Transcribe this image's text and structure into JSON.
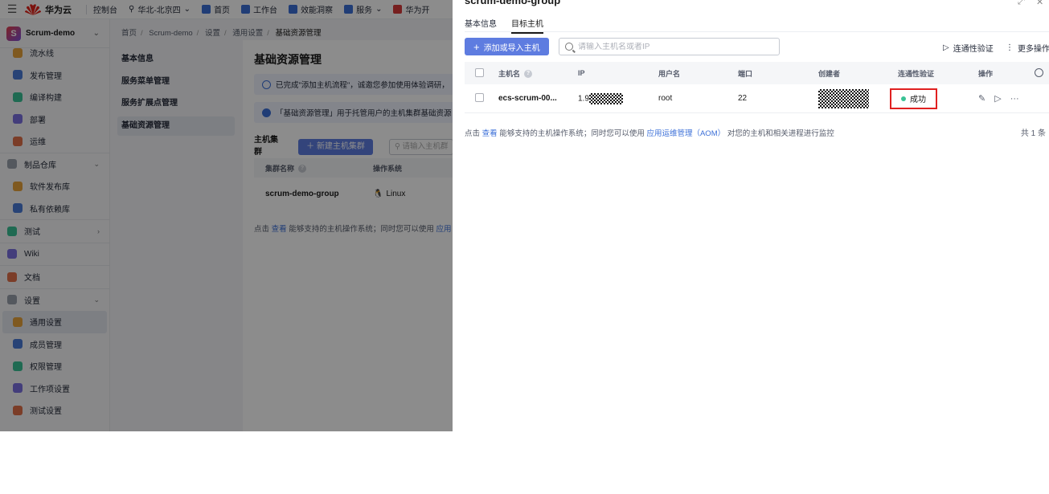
{
  "topnav": {
    "brand": "华为云",
    "console": "控制台",
    "region": "华北-北京四",
    "items": [
      "首页",
      "工作台",
      "效能洞察",
      "服务",
      "华为开"
    ]
  },
  "sidebar": {
    "project": "Scrum-demo",
    "items": [
      {
        "label": "流水线",
        "level": "sub"
      },
      {
        "label": "发布管理",
        "level": "sub"
      },
      {
        "label": "编译构建",
        "level": "sub"
      },
      {
        "label": "部署",
        "level": "sub"
      },
      {
        "label": "运维",
        "level": "sub"
      },
      {
        "label": "制品仓库",
        "level": "top",
        "arrow": "⌄"
      },
      {
        "label": "软件发布库",
        "level": "sub"
      },
      {
        "label": "私有依赖库",
        "level": "sub"
      },
      {
        "label": "测试",
        "level": "top",
        "arrow": "›"
      },
      {
        "label": "Wiki",
        "level": "top"
      },
      {
        "label": "文档",
        "level": "top"
      },
      {
        "label": "设置",
        "level": "top",
        "arrow": "⌄"
      },
      {
        "label": "通用设置",
        "level": "sub",
        "active": true
      },
      {
        "label": "成员管理",
        "level": "sub"
      },
      {
        "label": "权限管理",
        "level": "sub"
      },
      {
        "label": "工作项设置",
        "level": "sub"
      },
      {
        "label": "测试设置",
        "level": "sub"
      }
    ]
  },
  "breadcrumb": [
    "首页",
    "Scrum-demo",
    "设置",
    "通用设置",
    "基础资源管理"
  ],
  "secnav": [
    "基本信息",
    "服务菜单管理",
    "服务扩展点管理",
    "基础资源管理"
  ],
  "main": {
    "title": "基础资源管理",
    "notice1": "已完成\"添加主机流程\"，诚邀您参加使用体验调研，",
    "notice2": "「基础资源管理」用于托管用户的主机集群基础资源",
    "tab": "主机集群",
    "new_cluster": "新建主机集群",
    "search_placeholder": "请输入主机群",
    "col_name": "集群名称",
    "col_os": "操作系统",
    "row_name": "scrum-demo-group",
    "row_os": "Linux",
    "hint_prefix": "点击",
    "hint_link": "查看",
    "hint_mid": "能够支持的主机操作系统；同时您可以使用",
    "hint_link2": "应用"
  },
  "drawer": {
    "title": "scrum-demo-group",
    "tabs": [
      "基本信息",
      "目标主机"
    ],
    "add_button": "添加或导入主机",
    "search_placeholder": "请输入主机名或者IP",
    "connectivity": "连通性验证",
    "more_ops": "更多操作",
    "columns": [
      "主机名",
      "IP",
      "用户名",
      "端口",
      "创建者",
      "连通性验证",
      "操作"
    ],
    "rows": [
      {
        "host": "ecs-scrum-00...",
        "ip": "1.9",
        "user": "root",
        "port": "22",
        "status": "成功"
      }
    ],
    "hint_prefix": "点击",
    "hint_link": "查看",
    "hint_mid": "能够支持的主机操作系统；同时您可以使用",
    "hint_link2": "应用运维管理（AOM）",
    "hint_suffix": "对您的主机和相关进程进行监控",
    "total": "共 1 条"
  },
  "colors": {
    "primary": "#5e7ce0",
    "link": "#3b6fd8",
    "success": "#3ac295",
    "highlight": "#e02020"
  }
}
